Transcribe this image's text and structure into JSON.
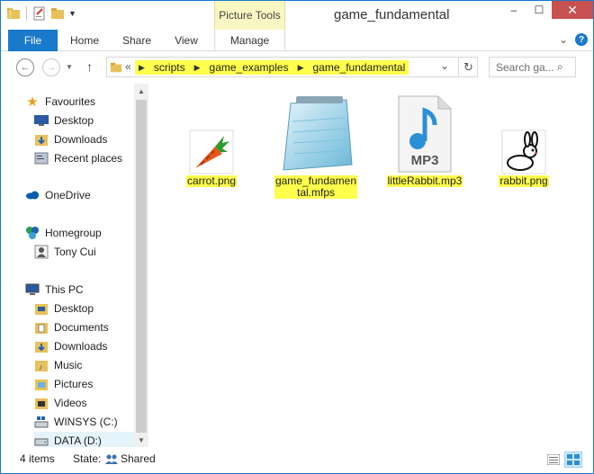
{
  "window": {
    "title": "game_fundamental",
    "context_tab_group": "Picture Tools",
    "controls": {
      "minimize": "–",
      "maximize": "☐",
      "close": "✕"
    }
  },
  "ribbon": {
    "tabs": [
      "File",
      "Home",
      "Share",
      "View",
      "Manage"
    ],
    "expand_icon": "⌄",
    "help_icon": "?"
  },
  "address": {
    "overflow": "«",
    "path": [
      "scripts",
      "game_examples",
      "game_fundamental"
    ],
    "dropdown": "⌄",
    "refresh": "↻"
  },
  "search": {
    "placeholder": "Search ga..."
  },
  "navigation": {
    "favourites": {
      "label": "Favourites",
      "items": [
        "Desktop",
        "Downloads",
        "Recent places"
      ]
    },
    "onedrive": "OneDrive",
    "homegroup": {
      "label": "Homegroup",
      "items": [
        "Tony Cui"
      ]
    },
    "this_pc": {
      "label": "This PC",
      "items": [
        "Desktop",
        "Documents",
        "Downloads",
        "Music",
        "Pictures",
        "Videos",
        "WINSYS (C:)",
        "DATA (D:)"
      ]
    }
  },
  "files": [
    {
      "name_lines": [
        "carrot.png"
      ],
      "icon": "carrot-icon"
    },
    {
      "name_lines": [
        "game_fundamen",
        "tal.mfps"
      ],
      "icon": "notepad-icon"
    },
    {
      "name_lines": [
        "littleRabbit.mp3"
      ],
      "icon": "mp3-icon"
    },
    {
      "name_lines": [
        "rabbit.png"
      ],
      "icon": "rabbit-icon"
    }
  ],
  "mp3_badge": "MP3",
  "status": {
    "count": "4 items",
    "state_label": "State:",
    "state_value": "Shared"
  },
  "colors": {
    "accent": "#1979ca",
    "highlight": "#ffff4c",
    "context": "#fbf7c4"
  }
}
